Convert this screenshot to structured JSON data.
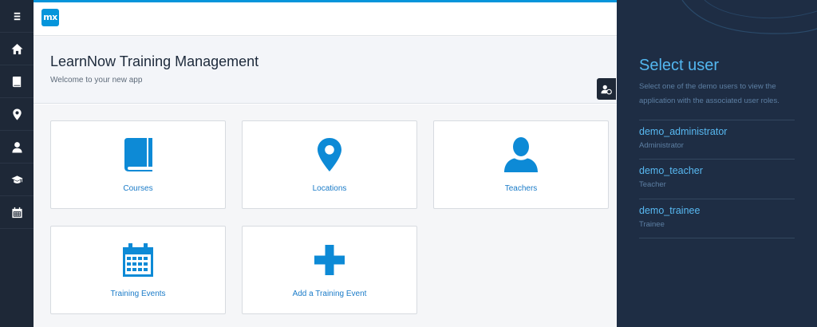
{
  "app": {
    "logo_text": "mx",
    "title": "LearnNow Training Management",
    "subtitle": "Welcome to your new app"
  },
  "sidebar": {
    "items": [
      {
        "icon": "menu-icon"
      },
      {
        "icon": "home-icon"
      },
      {
        "icon": "book-icon"
      },
      {
        "icon": "map-marker-icon"
      },
      {
        "icon": "user-icon"
      },
      {
        "icon": "graduation-cap-icon"
      },
      {
        "icon": "calendar-icon"
      }
    ]
  },
  "tiles": [
    {
      "label": "Courses",
      "icon": "book-icon"
    },
    {
      "label": "Locations",
      "icon": "map-marker-icon"
    },
    {
      "label": "Teachers",
      "icon": "user-icon"
    },
    {
      "label": "Training Events",
      "icon": "calendar-icon"
    },
    {
      "label": "Add a Training Event",
      "icon": "plus-icon"
    }
  ],
  "role_panel": {
    "title": "Select user",
    "description": "Select one of the demo users to view the application with the associated user roles.",
    "users": [
      {
        "name": "demo_administrator",
        "role": "Administrator"
      },
      {
        "name": "demo_teacher",
        "role": "Teacher"
      },
      {
        "name": "demo_trainee",
        "role": "Trainee"
      }
    ]
  },
  "colors": {
    "accent": "#0595db",
    "sidebar_bg": "#1e2837",
    "panel_bg": "#1e2d44",
    "panel_link": "#53b7f0",
    "tile_icon": "#0d8ad6"
  }
}
